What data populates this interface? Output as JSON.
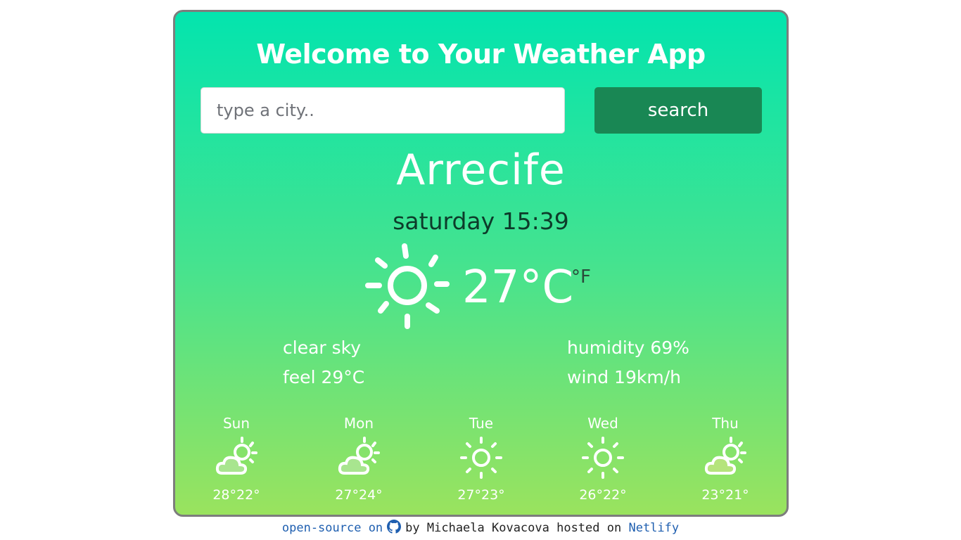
{
  "app": {
    "title": "Welcome to Your Weather App"
  },
  "search": {
    "placeholder": "type a city..",
    "value": "",
    "button_label": "search"
  },
  "current": {
    "city": "Arrecife",
    "datetime": "saturday 15:39",
    "icon": "sun-icon",
    "temperature": "27°C",
    "alt_unit": "°F",
    "description": "clear sky",
    "feel": "feel 29°C",
    "humidity": "humidity 69%",
    "wind": "wind 19km/h"
  },
  "forecast": [
    {
      "day": "Sun",
      "icon": "partly-cloudy-icon",
      "temps": "28°22°"
    },
    {
      "day": "Mon",
      "icon": "partly-cloudy-icon",
      "temps": "27°24°"
    },
    {
      "day": "Tue",
      "icon": "sun-icon",
      "temps": "27°23°"
    },
    {
      "day": "Wed",
      "icon": "sun-icon",
      "temps": "26°22°"
    },
    {
      "day": "Thu",
      "icon": "partly-cloudy-icon",
      "temps": "23°21°"
    }
  ],
  "footer": {
    "open_source_link": "open-source on",
    "icon": "github-icon",
    "by_text": "by Michaela Kovacova hosted on",
    "host_link": "Netlify"
  },
  "colors": {
    "gradient_top": "#03e4ae",
    "gradient_bottom": "#9ae35e",
    "button": "#198754",
    "link": "#1f5fb0"
  }
}
